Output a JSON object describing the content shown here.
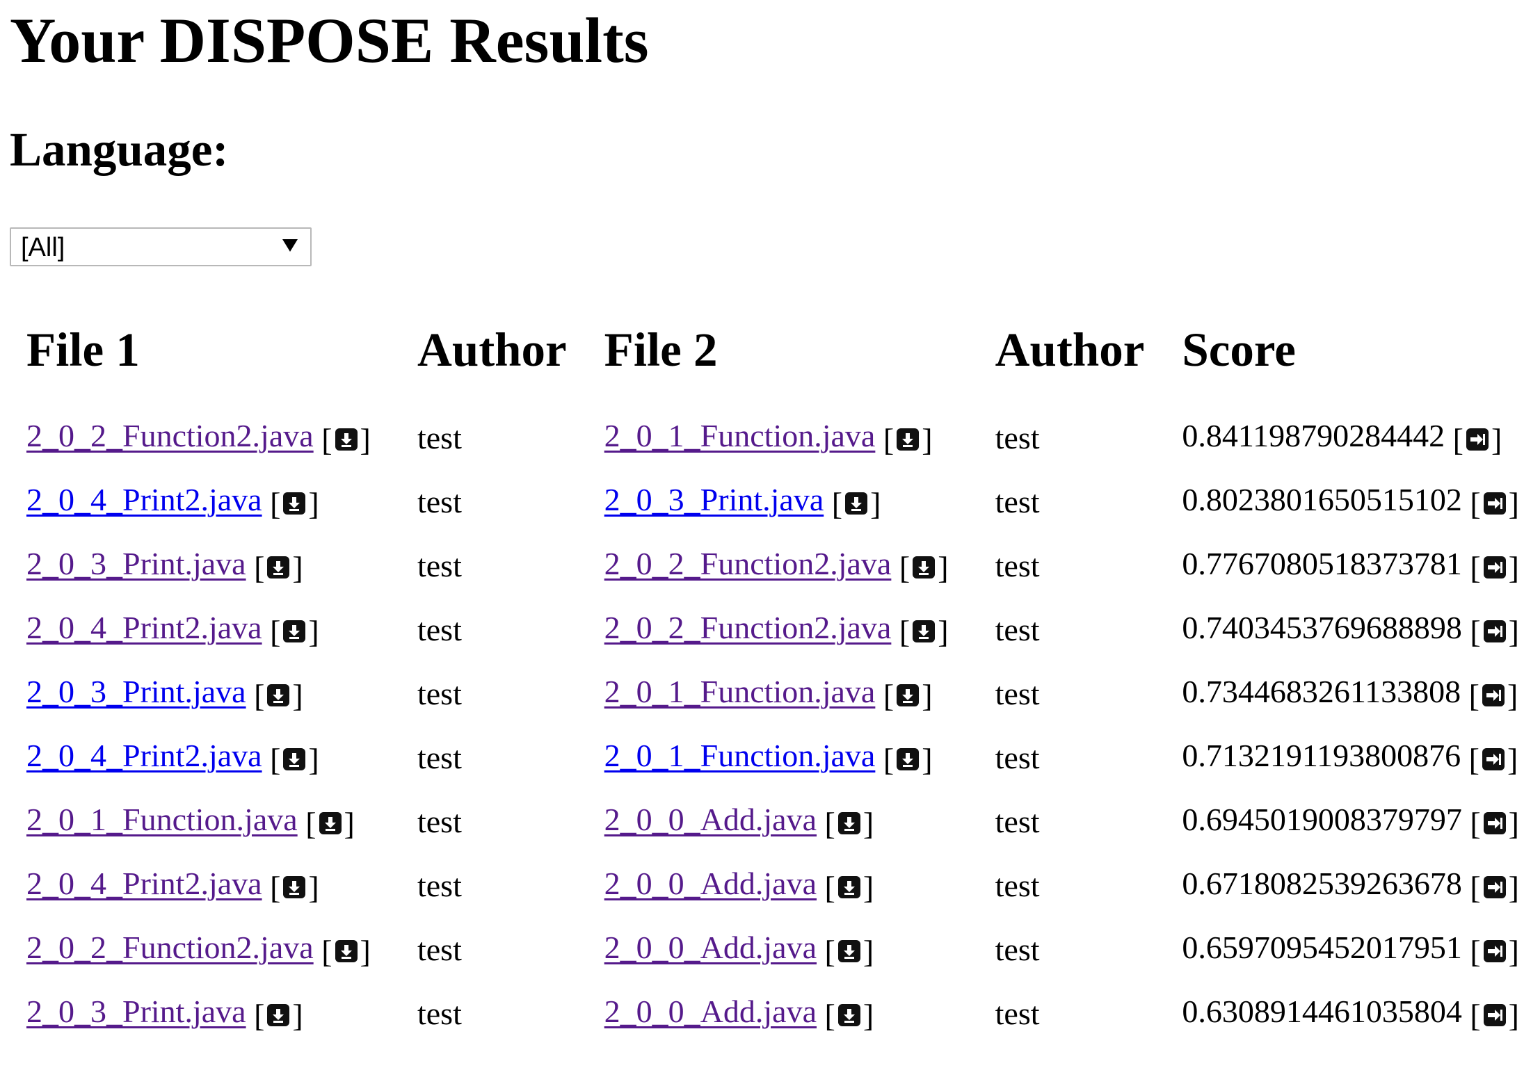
{
  "page": {
    "title": "Your DISPOSE Results",
    "language_label": "Language:"
  },
  "language_select": {
    "selected": "[All]"
  },
  "table": {
    "headers": [
      "File 1",
      "Author",
      "File 2",
      "Author",
      "Score"
    ],
    "rows": [
      {
        "file1": "2_0_2_Function2.java",
        "author1": "test",
        "file2": "2_0_1_Function.java",
        "author2": "test",
        "score": "0.841198790284442"
      },
      {
        "file1": "2_0_4_Print2.java",
        "author1": "test",
        "file2": "2_0_3_Print.java",
        "author2": "test",
        "score": "0.8023801650515102"
      },
      {
        "file1": "2_0_3_Print.java",
        "author1": "test",
        "file2": "2_0_2_Function2.java",
        "author2": "test",
        "score": "0.7767080518373781"
      },
      {
        "file1": "2_0_4_Print2.java",
        "author1": "test",
        "file2": "2_0_2_Function2.java",
        "author2": "test",
        "score": "0.7403453769688898"
      },
      {
        "file1": "2_0_3_Print.java",
        "author1": "test",
        "file2": "2_0_1_Function.java",
        "author2": "test",
        "score": "0.7344683261133808"
      },
      {
        "file1": "2_0_4_Print2.java",
        "author1": "test",
        "file2": "2_0_1_Function.java",
        "author2": "test",
        "score": "0.7132191193800876"
      },
      {
        "file1": "2_0_1_Function.java",
        "author1": "test",
        "file2": "2_0_0_Add.java",
        "author2": "test",
        "score": "0.6945019008379797"
      },
      {
        "file1": "2_0_4_Print2.java",
        "author1": "test",
        "file2": "2_0_0_Add.java",
        "author2": "test",
        "score": "0.6718082539263678"
      },
      {
        "file1": "2_0_2_Function2.java",
        "author1": "test",
        "file2": "2_0_0_Add.java",
        "author2": "test",
        "score": "0.6597095452017951"
      },
      {
        "file1": "2_0_3_Print.java",
        "author1": "test",
        "file2": "2_0_0_Add.java",
        "author2": "test",
        "score": "0.6308914461035804"
      }
    ]
  },
  "icons": {
    "file_action": "download-icon",
    "score_action": "compare-arrow-icon"
  },
  "colors": {
    "link_visited": "#551a8b",
    "link_unvisited": "#0000ee",
    "icon_bg": "#111111"
  }
}
